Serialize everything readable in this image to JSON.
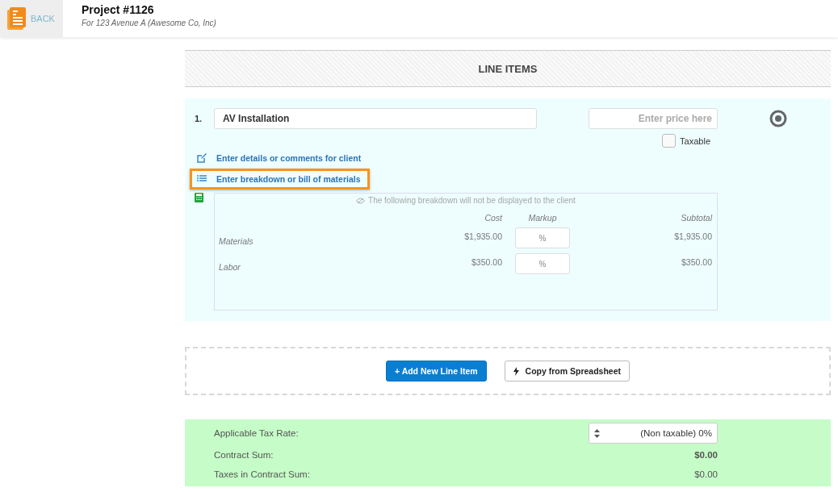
{
  "header": {
    "back_label": "BACK",
    "title": "Project #1126",
    "subtitle": "For 123 Avenue A (Awesome Co, Inc)"
  },
  "section_title": "LINE ITEMS",
  "line_item": {
    "number": "1.",
    "name": "AV Installation",
    "price_placeholder": "Enter price here",
    "taxable": {
      "label": "Taxable",
      "checked": false
    },
    "links": [
      {
        "kind": "details",
        "label": "Enter details or comments for client",
        "highlighted": false
      },
      {
        "kind": "breakdown",
        "label": "Enter breakdown or bill of materials",
        "highlighted": true
      }
    ],
    "breakdown": {
      "notice": "The following breakdown will not be displayed to the client",
      "columns": [
        "Cost",
        "Markup",
        "Subtotal"
      ],
      "rows": [
        {
          "name": "Materials",
          "cost": "$1,935.00",
          "markup_placeholder": "%",
          "subtotal": "$1,935.00"
        },
        {
          "name": "Labor",
          "cost": "$350.00",
          "markup_placeholder": "%",
          "subtotal": "$350.00"
        }
      ]
    }
  },
  "actions": {
    "add": "+ Add New Line Item",
    "copy": "Copy from Spreadsheet"
  },
  "summary": {
    "tax_rate_label": "Applicable Tax Rate:",
    "tax_rate_value": "(Non taxable) 0%",
    "rows": [
      {
        "label": "Contract Sum:",
        "value": "$0.00",
        "bold": true
      },
      {
        "label": "Taxes in Contract Sum:",
        "value": "$0.00",
        "bold": false
      }
    ]
  }
}
